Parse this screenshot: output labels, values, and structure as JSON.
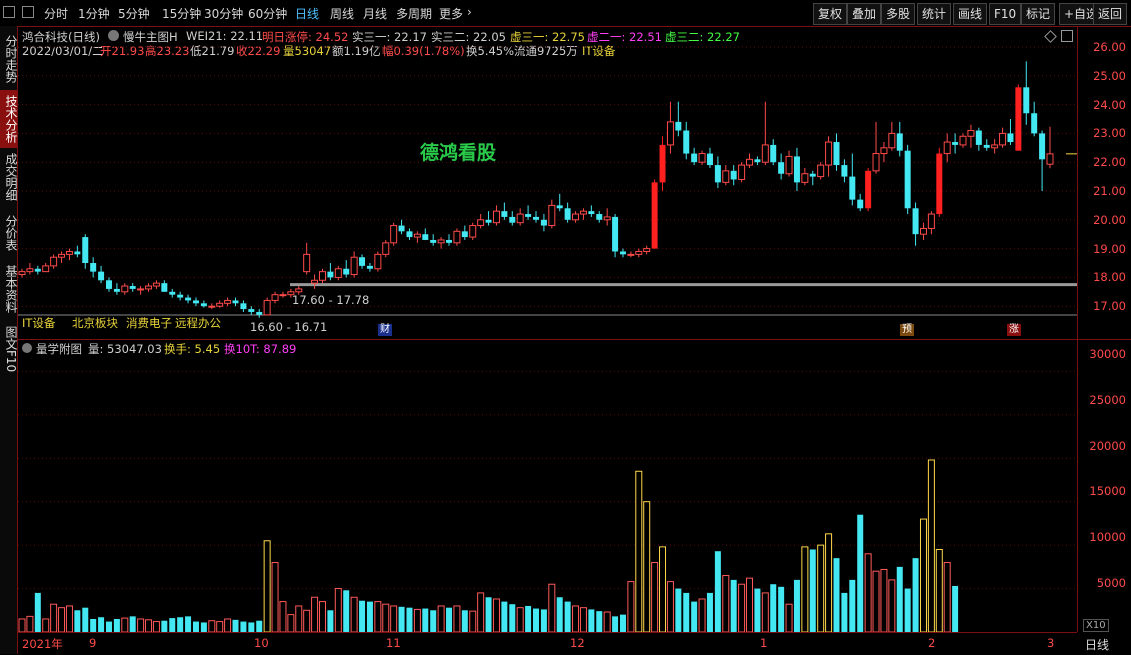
{
  "toolbar": {
    "left_items": [
      {
        "label": "分时",
        "active": false
      },
      {
        "label": "1分钟",
        "active": false
      },
      {
        "label": "5分钟",
        "active": false
      },
      {
        "label": "15分钟",
        "active": false
      },
      {
        "label": "30分钟",
        "active": false
      },
      {
        "label": "60分钟",
        "active": false
      },
      {
        "label": "日线",
        "active": true
      },
      {
        "label": "周线",
        "active": false
      },
      {
        "label": "月线",
        "active": false
      },
      {
        "label": "多周期",
        "active": false
      },
      {
        "label": "更多",
        "active": false
      }
    ],
    "right_buttons": [
      "复权",
      "叠加",
      "多股",
      "统计",
      "画线",
      "F10",
      "标记",
      "+自选",
      "返回"
    ]
  },
  "left_tabs": [
    {
      "label": "分时走势",
      "active": false
    },
    {
      "label": "技术分析",
      "active": true
    },
    {
      "label": "成交明细",
      "active": false
    },
    {
      "label": "分价表",
      "active": false
    },
    {
      "label": "基本资料",
      "active": false
    },
    {
      "label": "图文F10",
      "active": false
    }
  ],
  "main_chart": {
    "stock_title": "鸿合科技(日线)",
    "indicator_name": "慢牛主图H",
    "wei21": "WEI21: 22.11",
    "next_limit_up": "明日涨停: 24.52",
    "shi3_1": "实三一: 22.17",
    "shi3_2": "实三二: 22.05",
    "xu3_1": "虚三一: 22.75",
    "xu2_1": "虚二一: 22.51",
    "xu3_2": "虚三二: 22.27",
    "date": "2022/03/01/二",
    "open": "开21.93",
    "high": "高23.23",
    "low": "低21.79",
    "close": "收22.29",
    "volume": "量53047",
    "amount": "额1.19亿",
    "change": "幅0.39(1.78%)",
    "turnover": "换5.45%",
    "float_shares": "流通9725万",
    "industry": "IT设备",
    "watermark": "德鸿看股",
    "tags": [
      "IT设备",
      "北京板块",
      "消费电子",
      "远程办公"
    ],
    "range_label_1": "17.60 - 17.78",
    "range_label_2": "16.60 - 16.71",
    "markers": [
      "财",
      "预",
      "涨"
    ],
    "price_ticks": [
      "26.00",
      "25.00",
      "24.00",
      "23.00",
      "22.00",
      "21.00",
      "20.00",
      "19.00",
      "18.00",
      "17.00"
    ]
  },
  "volume_chart": {
    "title": "量学附图",
    "vol": "量: 53047.03",
    "turnover": "换手: 5.45",
    "turnover10": "换10T: 87.89",
    "ticks": [
      "30000",
      "25000",
      "20000",
      "15000",
      "10000",
      "5000"
    ],
    "unit": "X10"
  },
  "date_axis": {
    "labels": [
      "2021年",
      "9",
      "10",
      "11",
      "12",
      "1",
      "2",
      "3"
    ],
    "period_button": "日线"
  },
  "colors": {
    "up": "#ff3b3b",
    "down": "#44e8f2",
    "bg": "#000000",
    "grid": "#7a1010"
  },
  "chart_data": {
    "type": "candlestick",
    "title": "鸿合科技(日线)",
    "ylim": [
      16.5,
      26.5
    ],
    "candles": [
      [
        18.1,
        18.3,
        18.0,
        18.2
      ],
      [
        18.2,
        18.5,
        18.1,
        18.3
      ],
      [
        18.3,
        18.4,
        18.1,
        18.2
      ],
      [
        18.2,
        18.5,
        18.2,
        18.4
      ],
      [
        18.4,
        18.8,
        18.3,
        18.7
      ],
      [
        18.7,
        18.9,
        18.5,
        18.8
      ],
      [
        18.8,
        19.0,
        18.6,
        18.9
      ],
      [
        18.9,
        19.1,
        18.7,
        18.8
      ],
      [
        19.4,
        19.5,
        18.3,
        18.5
      ],
      [
        18.5,
        18.7,
        18.0,
        18.2
      ],
      [
        18.2,
        18.4,
        17.8,
        17.9
      ],
      [
        17.9,
        18.0,
        17.5,
        17.6
      ],
      [
        17.6,
        17.8,
        17.4,
        17.5
      ],
      [
        17.5,
        17.8,
        17.4,
        17.7
      ],
      [
        17.7,
        17.8,
        17.5,
        17.6
      ],
      [
        17.6,
        17.7,
        17.4,
        17.6
      ],
      [
        17.6,
        17.8,
        17.5,
        17.7
      ],
      [
        17.7,
        17.9,
        17.6,
        17.8
      ],
      [
        17.8,
        17.9,
        17.5,
        17.5
      ],
      [
        17.5,
        17.6,
        17.3,
        17.4
      ],
      [
        17.4,
        17.5,
        17.2,
        17.3
      ],
      [
        17.3,
        17.4,
        17.1,
        17.2
      ],
      [
        17.2,
        17.3,
        17.0,
        17.1
      ],
      [
        17.1,
        17.2,
        16.95,
        17.0
      ],
      [
        17.0,
        17.1,
        16.9,
        17.0
      ],
      [
        17.0,
        17.2,
        16.95,
        17.1
      ],
      [
        17.1,
        17.3,
        17.0,
        17.2
      ],
      [
        17.2,
        17.3,
        17.0,
        17.1
      ],
      [
        17.1,
        17.2,
        16.8,
        16.9
      ],
      [
        16.9,
        17.0,
        16.7,
        16.8
      ],
      [
        16.8,
        16.9,
        16.6,
        16.7
      ],
      [
        16.7,
        17.3,
        16.7,
        17.2
      ],
      [
        17.2,
        17.5,
        17.1,
        17.4
      ],
      [
        17.4,
        17.5,
        17.3,
        17.4
      ],
      [
        17.4,
        17.6,
        17.3,
        17.5
      ],
      [
        17.5,
        17.7,
        17.4,
        17.6
      ],
      [
        18.2,
        19.2,
        18.1,
        18.8
      ],
      [
        17.8,
        18.1,
        17.6,
        17.9
      ],
      [
        17.9,
        18.3,
        17.8,
        18.2
      ],
      [
        18.2,
        18.5,
        17.9,
        18.0
      ],
      [
        18.0,
        18.4,
        17.9,
        18.3
      ],
      [
        18.3,
        18.6,
        18.0,
        18.1
      ],
      [
        18.1,
        18.9,
        18.0,
        18.7
      ],
      [
        18.7,
        18.8,
        18.3,
        18.4
      ],
      [
        18.4,
        18.5,
        18.2,
        18.3
      ],
      [
        18.3,
        18.9,
        18.2,
        18.8
      ],
      [
        18.8,
        19.3,
        18.7,
        19.2
      ],
      [
        19.2,
        19.9,
        19.1,
        19.8
      ],
      [
        19.8,
        20.0,
        19.5,
        19.6
      ],
      [
        19.6,
        19.7,
        19.3,
        19.4
      ],
      [
        19.4,
        19.6,
        19.2,
        19.5
      ],
      [
        19.5,
        19.7,
        19.3,
        19.3
      ],
      [
        19.3,
        19.5,
        19.1,
        19.2
      ],
      [
        19.2,
        19.4,
        19.0,
        19.3
      ],
      [
        19.3,
        19.5,
        19.1,
        19.2
      ],
      [
        19.2,
        19.7,
        19.1,
        19.6
      ],
      [
        19.6,
        19.8,
        19.3,
        19.4
      ],
      [
        19.4,
        19.9,
        19.3,
        19.8
      ],
      [
        19.8,
        20.2,
        19.7,
        20.0
      ],
      [
        20.0,
        20.3,
        19.8,
        19.9
      ],
      [
        19.9,
        20.5,
        19.8,
        20.3
      ],
      [
        20.3,
        20.6,
        20.0,
        20.1
      ],
      [
        20.1,
        20.3,
        19.8,
        19.9
      ],
      [
        19.9,
        20.4,
        19.8,
        20.2
      ],
      [
        20.2,
        20.5,
        20.0,
        20.1
      ],
      [
        20.1,
        20.3,
        19.9,
        20.0
      ],
      [
        20.0,
        20.2,
        19.6,
        19.8
      ],
      [
        19.8,
        20.7,
        19.7,
        20.5
      ],
      [
        20.5,
        20.9,
        20.3,
        20.4
      ],
      [
        20.4,
        20.6,
        19.9,
        20.0
      ],
      [
        20.0,
        20.3,
        19.9,
        20.2
      ],
      [
        20.2,
        20.4,
        20.0,
        20.3
      ],
      [
        20.3,
        20.5,
        20.1,
        20.2
      ],
      [
        20.2,
        20.3,
        19.9,
        20.0
      ],
      [
        20.0,
        20.4,
        19.8,
        20.1
      ],
      [
        20.1,
        20.2,
        18.7,
        18.9
      ],
      [
        18.9,
        19.0,
        18.7,
        18.8
      ],
      [
        18.8,
        18.9,
        18.7,
        18.8
      ],
      [
        18.8,
        19.0,
        18.7,
        18.9
      ],
      [
        18.9,
        19.1,
        18.8,
        19.0
      ],
      [
        19.0,
        21.4,
        19.0,
        21.3
      ],
      [
        21.3,
        22.9,
        21.0,
        22.6
      ],
      [
        22.6,
        24.1,
        22.3,
        23.4
      ],
      [
        23.4,
        24.1,
        22.9,
        23.1
      ],
      [
        23.1,
        23.4,
        22.1,
        22.3
      ],
      [
        22.3,
        22.5,
        21.9,
        22.0
      ],
      [
        22.0,
        22.4,
        21.9,
        22.3
      ],
      [
        22.3,
        22.5,
        21.8,
        21.9
      ],
      [
        21.9,
        22.2,
        21.1,
        21.3
      ],
      [
        21.3,
        21.9,
        21.2,
        21.7
      ],
      [
        21.7,
        21.9,
        21.2,
        21.4
      ],
      [
        21.4,
        22.0,
        21.3,
        21.9
      ],
      [
        21.9,
        22.3,
        21.8,
        22.1
      ],
      [
        22.1,
        22.2,
        21.9,
        22.0
      ],
      [
        22.0,
        24.1,
        21.9,
        22.6
      ],
      [
        22.6,
        22.8,
        21.9,
        22.0
      ],
      [
        22.0,
        22.3,
        21.4,
        21.6
      ],
      [
        21.6,
        22.4,
        21.5,
        22.2
      ],
      [
        22.2,
        22.5,
        21.0,
        21.3
      ],
      [
        21.3,
        21.8,
        21.2,
        21.6
      ],
      [
        21.6,
        21.7,
        21.2,
        21.5
      ],
      [
        21.5,
        22.0,
        21.4,
        21.9
      ],
      [
        21.9,
        22.9,
        21.5,
        22.7
      ],
      [
        22.7,
        23.0,
        21.7,
        21.9
      ],
      [
        21.9,
        22.1,
        21.3,
        21.5
      ],
      [
        21.5,
        22.3,
        20.5,
        20.7
      ],
      [
        20.7,
        20.9,
        20.3,
        20.4
      ],
      [
        20.4,
        21.8,
        20.3,
        21.7
      ],
      [
        21.7,
        23.4,
        21.6,
        22.3
      ],
      [
        22.3,
        22.7,
        22.0,
        22.5
      ],
      [
        22.5,
        23.4,
        22.4,
        23.0
      ],
      [
        23.0,
        23.4,
        22.2,
        22.4
      ],
      [
        22.4,
        22.6,
        20.2,
        20.4
      ],
      [
        20.4,
        20.6,
        19.1,
        19.5
      ],
      [
        19.5,
        19.9,
        19.3,
        19.7
      ],
      [
        19.7,
        20.3,
        19.5,
        20.2
      ],
      [
        20.2,
        22.5,
        20.1,
        22.3
      ],
      [
        22.3,
        23.0,
        22.0,
        22.7
      ],
      [
        22.7,
        23.0,
        22.3,
        22.6
      ],
      [
        22.6,
        23.0,
        22.5,
        22.9
      ],
      [
        22.9,
        23.3,
        22.5,
        23.1
      ],
      [
        23.1,
        23.2,
        22.4,
        22.6
      ],
      [
        22.6,
        22.8,
        22.4,
        22.5
      ],
      [
        22.5,
        22.8,
        22.3,
        22.6
      ],
      [
        22.6,
        23.2,
        22.5,
        23.0
      ],
      [
        23.0,
        23.5,
        22.6,
        22.7
      ],
      [
        22.4,
        24.7,
        22.4,
        24.6
      ],
      [
        24.6,
        25.5,
        23.3,
        23.7
      ],
      [
        23.7,
        24.1,
        22.9,
        23.0
      ],
      [
        23.0,
        23.1,
        21.0,
        22.1
      ],
      [
        21.93,
        23.23,
        21.79,
        22.29
      ]
    ],
    "volumes": [
      1500,
      1800,
      4500,
      1500,
      3200,
      2800,
      3000,
      2500,
      2800,
      1500,
      1700,
      1200,
      1500,
      1600,
      1800,
      1500,
      1400,
      1200,
      1300,
      1600,
      1700,
      1800,
      1200,
      1100,
      1300,
      1200,
      1500,
      1400,
      1200,
      1100,
      1300,
      10500,
      8000,
      3500,
      2000,
      3000,
      2500,
      4000,
      3500,
      2500,
      5000,
      4800,
      4000,
      3600,
      3500,
      3500,
      3200,
      3000,
      2900,
      2800,
      2600,
      2700,
      2500,
      3000,
      2800,
      3000,
      2500,
      2400,
      4500,
      4000,
      3800,
      3500,
      3200,
      2800,
      3000,
      2700,
      2600,
      5500,
      4000,
      3500,
      3000,
      2800,
      2600,
      2400,
      2300,
      1800,
      2000,
      5800,
      18500,
      15000,
      8000,
      9800,
      5800,
      5000,
      4500,
      3500,
      3800,
      4500,
      9300,
      6500,
      6000,
      5500,
      6200,
      5000,
      4500,
      5500,
      5200,
      3200,
      6000,
      9800,
      9500,
      10000,
      11300,
      8500,
      4500,
      6000,
      13500,
      9000,
      7000,
      7200,
      6000,
      7500,
      5000,
      8500,
      13000,
      19800,
      9500,
      8000,
      5300
    ],
    "ylim_volume": [
      0,
      32000
    ]
  }
}
